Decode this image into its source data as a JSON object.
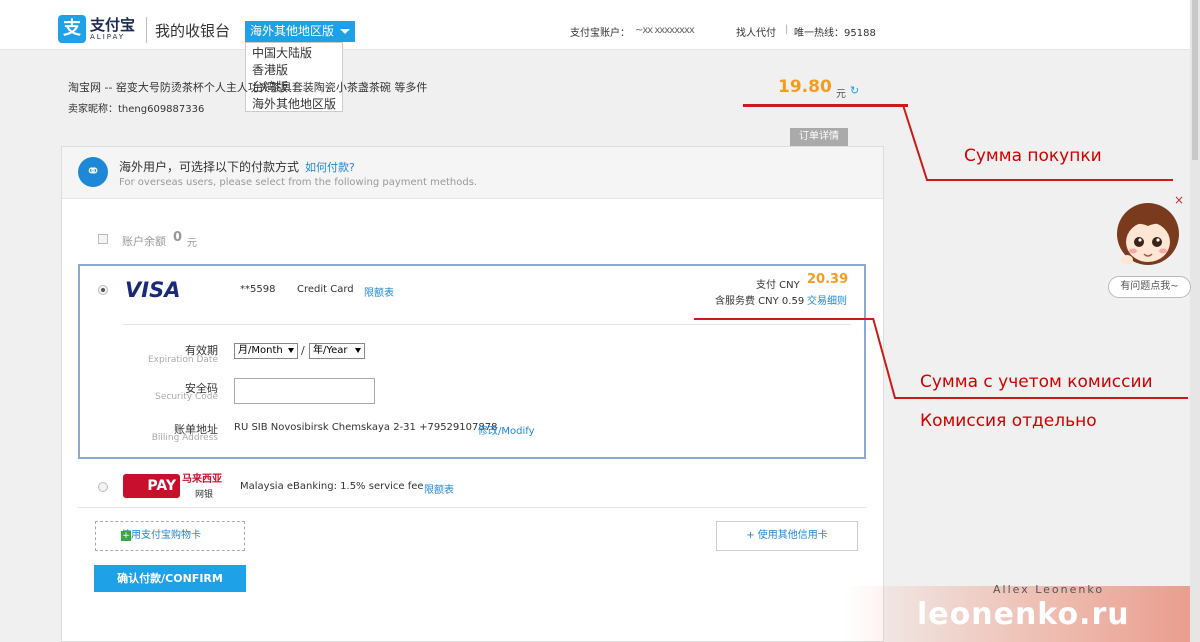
{
  "header": {
    "logo_cn": "支付宝",
    "logo_en": "ALIPAY",
    "cashier_title": "我的收银台",
    "region_selected": "海外其他地区版",
    "region_options": [
      "中国大陆版",
      "香港版",
      "台湾版",
      "海外其他地区版"
    ],
    "account_label": "支付宝账户：",
    "account_value": "~xx xxxxxxxx",
    "find_payer": "找人代付",
    "separator": "|",
    "hotline_label": "唯一热线：95188"
  },
  "order": {
    "title": "淘宝网 -- 窑变大号防烫茶杯个人主人功夫茶具套装陶瓷小茶盏茶碗 等多件",
    "seller": "卖家昵称：theng609887336",
    "amount": "19.80",
    "amount_unit": "元",
    "refresh_icon": "refresh-icon",
    "detail_tab": "订单详情"
  },
  "overseas": {
    "title": "海外用户，可选择以下的付款方式",
    "how_link": "如何付款?",
    "subtitle": "For overseas users, please select from the following payment methods."
  },
  "balance": {
    "label": "账户余额",
    "value": "0",
    "unit": "元"
  },
  "visa": {
    "brand": "VISA",
    "card_number": "**5598",
    "card_type": "Credit Card",
    "limit_link": "限额表",
    "pay_label": "支付 CNY",
    "pay_amount": "20.39",
    "fee_label": "含服务费 CNY 0.59",
    "fee_link": "交易细则",
    "expiration_label": "有效期",
    "expiration_sub": "Expiration Date",
    "month_value": "月/Month",
    "slash": "/",
    "year_value": "年/Year",
    "security_label": "安全码",
    "security_sub": "Security Code",
    "billing_label": "账单地址",
    "billing_sub": "Billing Address",
    "billing_address": "RU SIB Novosibirsk Chemskaya 2-31 +79529107878",
    "modify_link": "修改/Modify"
  },
  "mepay": {
    "logo": "PAY",
    "logo_cn": "马来西亚",
    "bank_cn": "网银",
    "description": "Malaysia eBanking: 1.5% service fee",
    "limit_link": "限额表"
  },
  "buttons": {
    "gift_card": "使用支付宝购物卡",
    "gift_plus": "+",
    "other_card": "+ 使用其他信用卡",
    "confirm": "确认付款/CONFIRM"
  },
  "annotations": {
    "purchase_sum": "Сумма покупки",
    "sum_with_fee": "Сумма с учетом комиссии",
    "fee_separately": "Комиссия отдельно"
  },
  "chat": {
    "close": "×",
    "help": "有问题点我~"
  },
  "watermark": {
    "author": "Allex Leonenko",
    "site": "leonenko.ru"
  },
  "colors": {
    "alipay_blue": "#1ea1e6",
    "amount_orange": "#f39c1f",
    "annotation_red": "#d00000",
    "visa_border": "#8ea8cf"
  }
}
